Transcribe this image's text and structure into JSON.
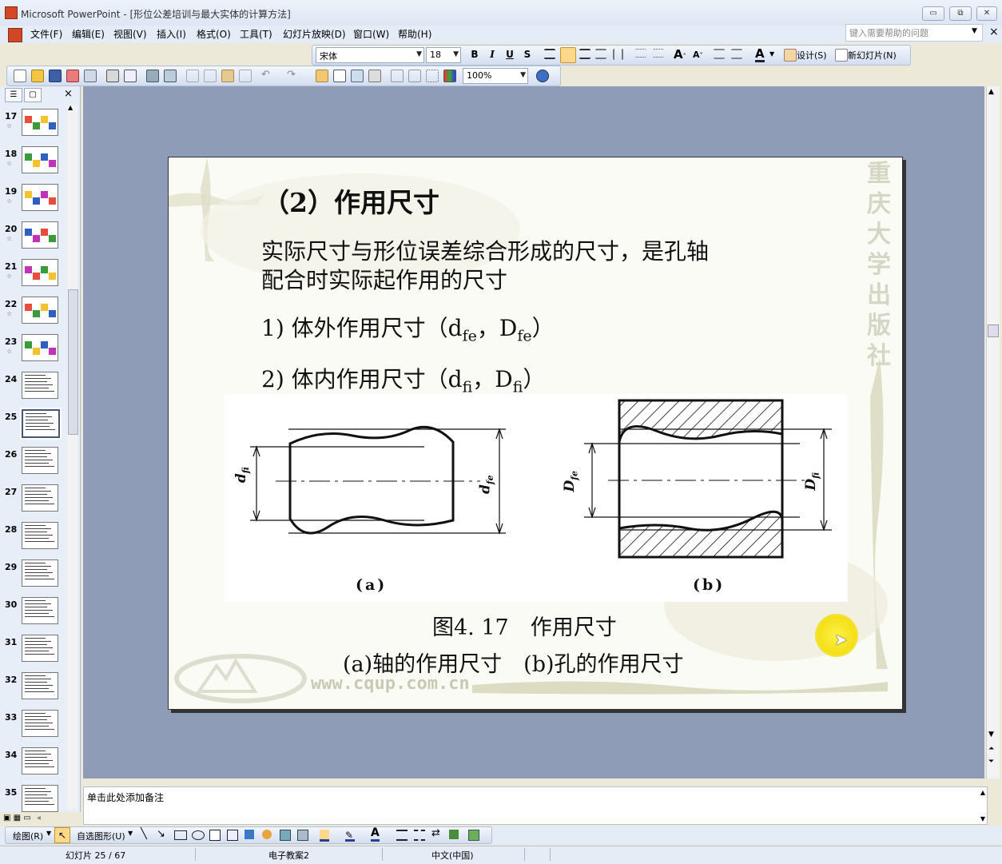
{
  "window": {
    "title": "Microsoft PowerPoint - [形位公差培训与最大实体的计算方法]",
    "buttons": {
      "minimize": "▭",
      "maximize": "⧉",
      "close": "✕"
    }
  },
  "menu": {
    "items": [
      "文件(F)",
      "编辑(E)",
      "视图(V)",
      "插入(I)",
      "格式(O)",
      "工具(T)",
      "幻灯片放映(D)",
      "窗口(W)",
      "帮助(H)"
    ],
    "help_placeholder": "键入需要帮助的问题"
  },
  "format_toolbar": {
    "font": "宋体",
    "size": "18",
    "bold": "B",
    "italic": "I",
    "underline": "U",
    "shadow": "S",
    "design_label": "设计(S)",
    "new_slide_label": "新幻灯片(N)"
  },
  "standard_toolbar": {
    "zoom": "100%"
  },
  "thumbnails": [
    {
      "num": "17",
      "type": "pic"
    },
    {
      "num": "18",
      "type": "pic"
    },
    {
      "num": "19",
      "type": "pic"
    },
    {
      "num": "20",
      "type": "pic"
    },
    {
      "num": "21",
      "type": "pic"
    },
    {
      "num": "22",
      "type": "pic"
    },
    {
      "num": "23",
      "type": "pic"
    },
    {
      "num": "24",
      "type": "text"
    },
    {
      "num": "25",
      "type": "text",
      "selected": true
    },
    {
      "num": "26",
      "type": "text"
    },
    {
      "num": "27",
      "type": "text"
    },
    {
      "num": "28",
      "type": "text"
    },
    {
      "num": "29",
      "type": "text"
    },
    {
      "num": "30",
      "type": "text"
    },
    {
      "num": "31",
      "type": "text"
    },
    {
      "num": "32",
      "type": "text"
    },
    {
      "num": "33",
      "type": "text"
    },
    {
      "num": "34",
      "type": "text"
    },
    {
      "num": "35",
      "type": "text"
    }
  ],
  "slide": {
    "title": "（2）作用尺寸",
    "body_line1": "实际尺寸与形位误差综合形成的尺寸，是孔轴",
    "body_line2": "配合时实际起作用的尺寸",
    "item1_prefix": "1) 体外作用尺寸（d",
    "item1_sub1": "fe",
    "item1_mid": "，D",
    "item1_sub2": "fe",
    "item1_suffix": "）",
    "item2_prefix": "2) 体内作用尺寸（d",
    "item2_sub1": "fi",
    "item2_mid": "，D",
    "item2_sub2": "fi",
    "item2_suffix": "）",
    "fig_a_label": "(a)",
    "fig_b_label": "(b)",
    "dim_a_left": "d",
    "dim_a_left_sub": "fi",
    "dim_a_right": "d",
    "dim_a_right_sub": "fe",
    "dim_b_left": "D",
    "dim_b_left_sub": "fe",
    "dim_b_right": "D",
    "dim_b_right_sub": "fi",
    "caption1": "图4. 17　作用尺寸",
    "caption2": "(a)轴的作用尺寸　(b)孔的作用尺寸",
    "watermark_vertical": "重庆大学出版社",
    "watermark_url": "www.cqup.com.cn"
  },
  "notes": {
    "placeholder": "单击此处添加备注"
  },
  "drawbar": {
    "draw_label": "绘图(R)",
    "autoshape_label": "自选图形(U)"
  },
  "status": {
    "slide": "幻灯片 25 / 67",
    "design": "电子教案2",
    "lang": "中文(中国)"
  }
}
